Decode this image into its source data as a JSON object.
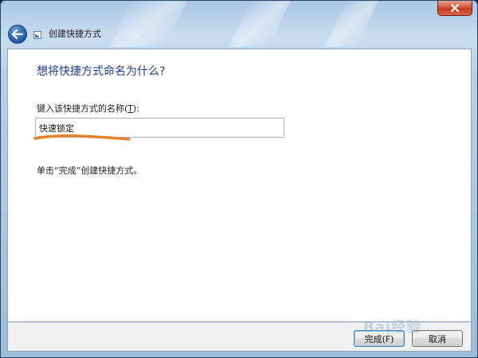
{
  "window": {
    "title": "创建快捷方式"
  },
  "content": {
    "heading": "想将快捷方式命名为什么?",
    "label_text": "键入该快捷方式的名称(",
    "label_accel": "T",
    "label_end": "):",
    "name_value": "快速锁定",
    "hint": "单击“完成”创建快捷方式。"
  },
  "footer": {
    "finish_label": "完成(F)",
    "cancel_label": "取消"
  },
  "watermark": "Bai经验",
  "colors": {
    "heading": "#1e3d8f",
    "scribble": "#e8822a",
    "close": "#c2391f",
    "back": "#2d65b0"
  }
}
